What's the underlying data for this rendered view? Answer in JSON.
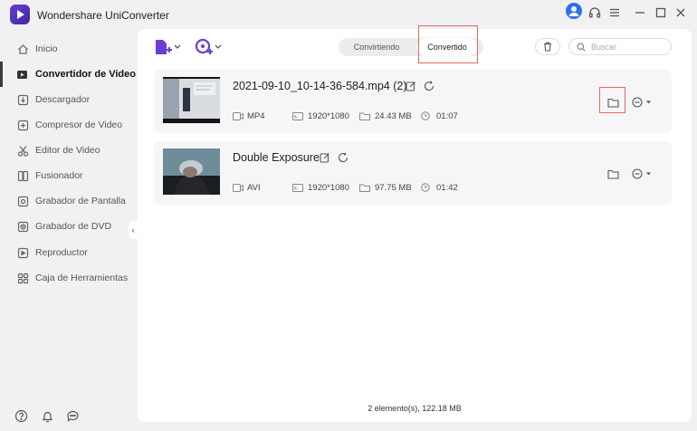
{
  "app": {
    "title": "Wondershare UniConverter"
  },
  "sidebar": {
    "items": [
      {
        "label": "Inicio",
        "icon": "home-icon"
      },
      {
        "label": "Convertidor de Video",
        "icon": "converter-icon",
        "active": true
      },
      {
        "label": "Descargador",
        "icon": "download-icon"
      },
      {
        "label": "Compresor de Video",
        "icon": "compress-icon"
      },
      {
        "label": "Editor de Video",
        "icon": "scissors-icon"
      },
      {
        "label": "Fusionador",
        "icon": "merge-icon"
      },
      {
        "label": "Grabador de Pantalla",
        "icon": "screen-record-icon"
      },
      {
        "label": "Grabador de DVD",
        "icon": "dvd-icon"
      },
      {
        "label": "Reproductor",
        "icon": "play-icon"
      },
      {
        "label": "Caja de Herramientas",
        "icon": "toolbox-icon"
      }
    ]
  },
  "tabs": {
    "converting": "Convirtiendo",
    "converted": "Convertido",
    "active": "converted"
  },
  "search": {
    "placeholder": "Buscar"
  },
  "files": [
    {
      "name": "2021-09-10_10-14-36-584.mp4 (2)",
      "format": "MP4",
      "resolution": "1920*1080",
      "size": "24.43 MB",
      "duration": "01:07"
    },
    {
      "name": "Double Exposure",
      "format": "AVI",
      "resolution": "1920*1080",
      "size": "97.75 MB",
      "duration": "01:42"
    }
  ],
  "status": {
    "summary": "2 elemento(s), 122.18 MB"
  },
  "colors": {
    "accent": "#2a73ee",
    "highlight_box": "#e36a5c",
    "logo": "#5a35c8"
  }
}
